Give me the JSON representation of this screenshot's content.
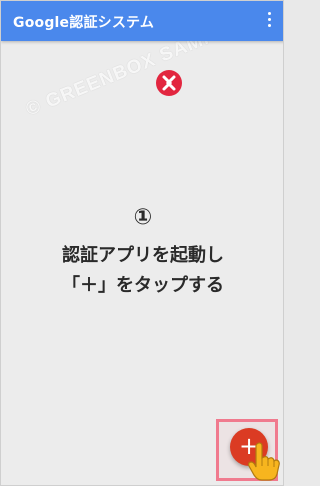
{
  "app_bar": {
    "title": "Google認証システム",
    "menu_icon": "more-vert-icon",
    "color": "#4a88ec"
  },
  "watermark": {
    "text": "© GREENBOX SAMPLE",
    "logo_icon": "greenbox-logo-icon"
  },
  "instruction": {
    "step": "①",
    "line1": "認証アプリを起動し",
    "line2": "「＋」をタップする"
  },
  "fab": {
    "label": "+",
    "color": "#db3b23",
    "highlight_color": "#f07a8e"
  },
  "pointer": {
    "icon": "pointing-hand-icon"
  }
}
